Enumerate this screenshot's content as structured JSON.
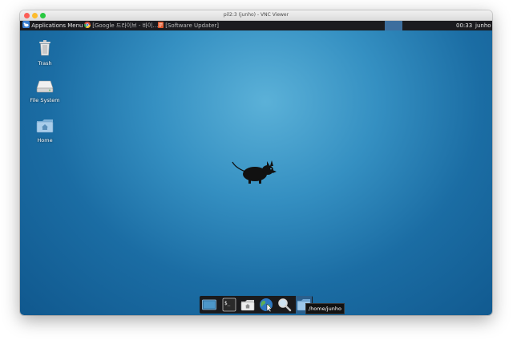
{
  "window": {
    "title": "pil2:3 (junho) - VNC Viewer"
  },
  "panel": {
    "applications_menu": "Applications Menu",
    "tasks": [
      {
        "label": "[Google 드라이브 - 바이…",
        "icon": "chrome-icon"
      },
      {
        "label": "[Software Updater]",
        "icon": "software-updater-icon"
      }
    ],
    "clock": "00:33",
    "user": "junho"
  },
  "desktop": {
    "icons": [
      {
        "label": "Trash",
        "icon": "trash-icon"
      },
      {
        "label": "File System",
        "icon": "drive-icon"
      },
      {
        "label": "Home",
        "icon": "home-folder-icon"
      }
    ],
    "wallpaper": "xfce-mouse-logo"
  },
  "dock": {
    "items": [
      {
        "name": "show-desktop",
        "icon": "desktop-icon"
      },
      {
        "name": "terminal",
        "icon": "terminal-icon"
      },
      {
        "name": "file-manager",
        "icon": "home-folder-icon"
      },
      {
        "name": "web-browser",
        "icon": "globe-icon"
      },
      {
        "name": "app-finder",
        "icon": "magnifier-icon"
      },
      {
        "name": "home-directory",
        "icon": "folder-icon"
      }
    ],
    "tooltip": "/home/junho"
  },
  "colors": {
    "panel_bg": "#1b1b1f",
    "desktop_center": "#5bb1d8",
    "desktop_edge": "#10588e",
    "active_workspace": "#3d6e9e"
  }
}
